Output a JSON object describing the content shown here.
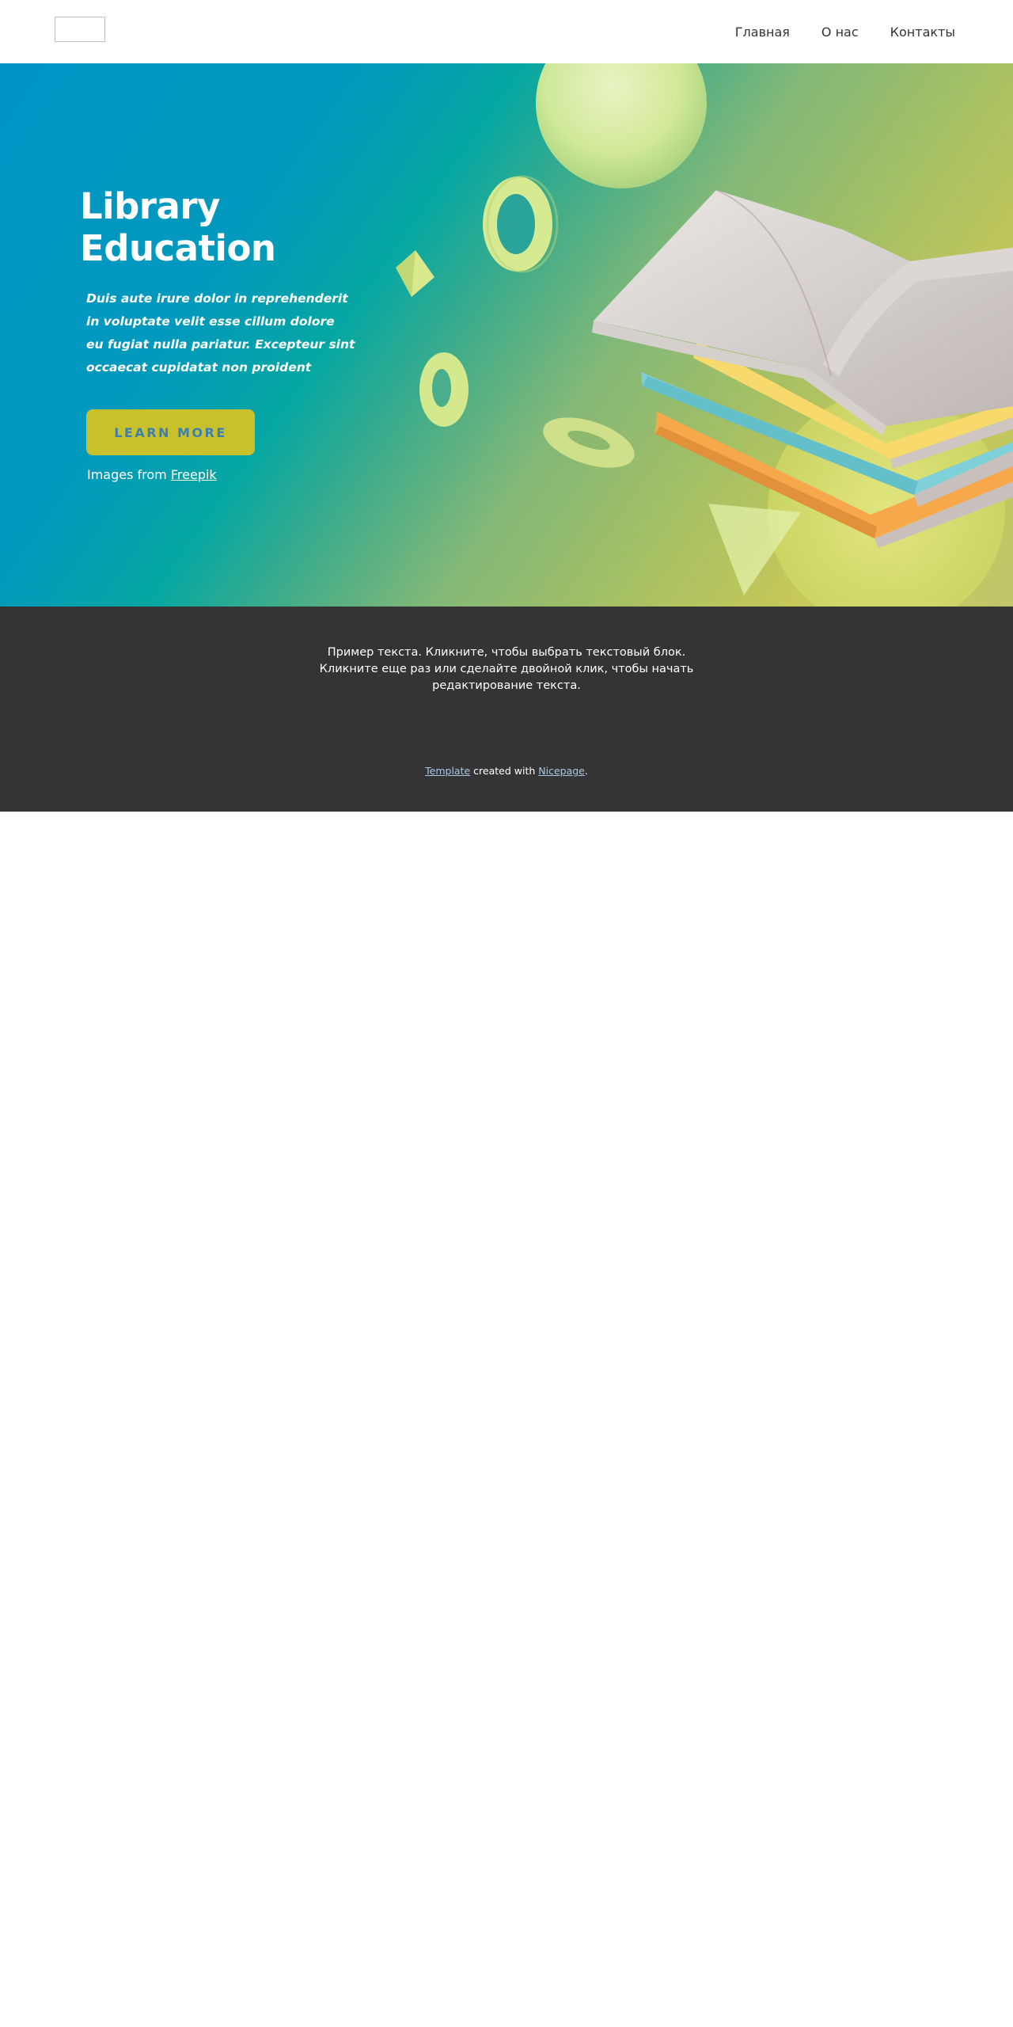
{
  "header": {
    "nav": [
      {
        "label": "Главная"
      },
      {
        "label": "О нас"
      },
      {
        "label": "Контакты"
      }
    ]
  },
  "hero": {
    "title_line1": "Library",
    "title_line2": "Education",
    "text": "Duis aute irure dolor in reprehenderit in voluptate velit esse cillum dolore eu fugiat nulla pariatur. Excepteur sint occaecat cupidatat non proident",
    "button_label": "LEARN MORE",
    "credit_prefix": "Images from ",
    "credit_link": "Freepik"
  },
  "info": {
    "text": "Пример текста. Кликните, чтобы выбрать текстовый блок. Кликните еще раз или сделайте двойной клик, чтобы начать редактирование текста."
  },
  "footer": {
    "template_link": "Template",
    "middle": " created with ",
    "nicepage_link": "Nicepage",
    "end": "."
  },
  "colors": {
    "button": "#c9c12c",
    "button_text": "#3d80b0",
    "dark_section": "#343434",
    "hero_gradient_start": "#0094c6",
    "hero_gradient_end": "#c6c858"
  }
}
